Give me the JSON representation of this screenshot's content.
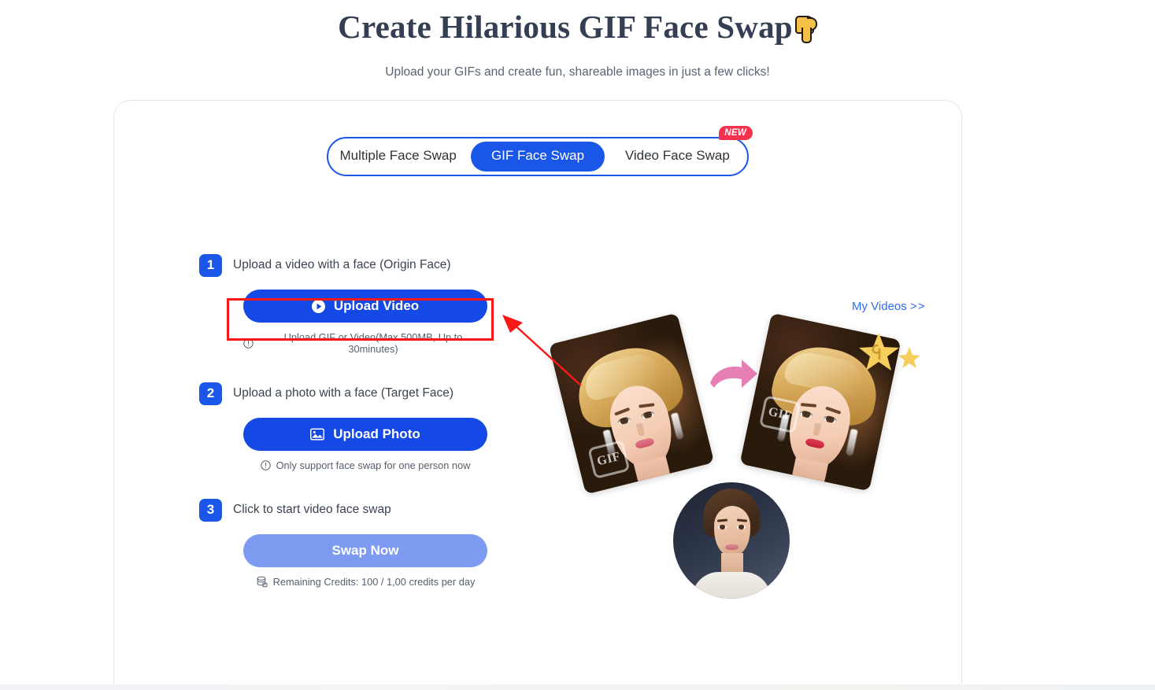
{
  "header": {
    "title": "Create Hilarious GIF Face Swap",
    "title_emoji": "point-down-hand",
    "subtitle": "Upload your GIFs and create fun, shareable images in just a few clicks!"
  },
  "tabs": {
    "items": [
      {
        "label": "Multiple Face Swap",
        "active": false
      },
      {
        "label": "GIF Face Swap",
        "active": true
      },
      {
        "label": "Video Face Swap",
        "active": false
      }
    ],
    "badge": "NEW"
  },
  "steps": [
    {
      "number": "1",
      "label": "Upload a video with a face",
      "label_note": "(Origin Face)",
      "button": "Upload Video",
      "button_icon": "play-circle-icon",
      "hint": "Upload GIF or Video(Max 500MB, Up to 30minutes)",
      "hint_icon": "info-icon",
      "highlighted": true
    },
    {
      "number": "2",
      "label": "Upload a photo with a face",
      "label_note": "(Target Face)",
      "button": "Upload Photo",
      "button_icon": "image-icon",
      "hint": "Only support face swap for one person now",
      "hint_icon": "info-icon",
      "highlighted": false
    },
    {
      "number": "3",
      "label": "Click to start video face swap",
      "label_note": "",
      "button": "Swap Now",
      "button_icon": "",
      "hint": "Remaining Credits:  100 / 1,00 credits per day",
      "hint_icon": "credits-icon",
      "highlighted": false,
      "disabled": true
    }
  ],
  "my_videos": {
    "label": "My Videos",
    "chevron": ">>"
  },
  "illustration": {
    "source_card_tag": "GIF",
    "result_card_tag": "GIF",
    "arrow_icon": "pink-curved-arrow",
    "sparkle_icon": "star-sparkle",
    "target_portrait": "circular-face-photo"
  },
  "annotation": {
    "arrow_color": "#fc1717",
    "box_color": "#fc1717"
  },
  "colors": {
    "accent_blue": "#1549e6",
    "tab_blue": "#1a56e8",
    "disabled_blue": "#7d9bf0",
    "badge_red": "#f5334f",
    "link_blue": "#2b6df5",
    "title_navy": "#353f54",
    "star_yellow": "#f5ce5b",
    "arrow_pink": "#e87fb4"
  }
}
